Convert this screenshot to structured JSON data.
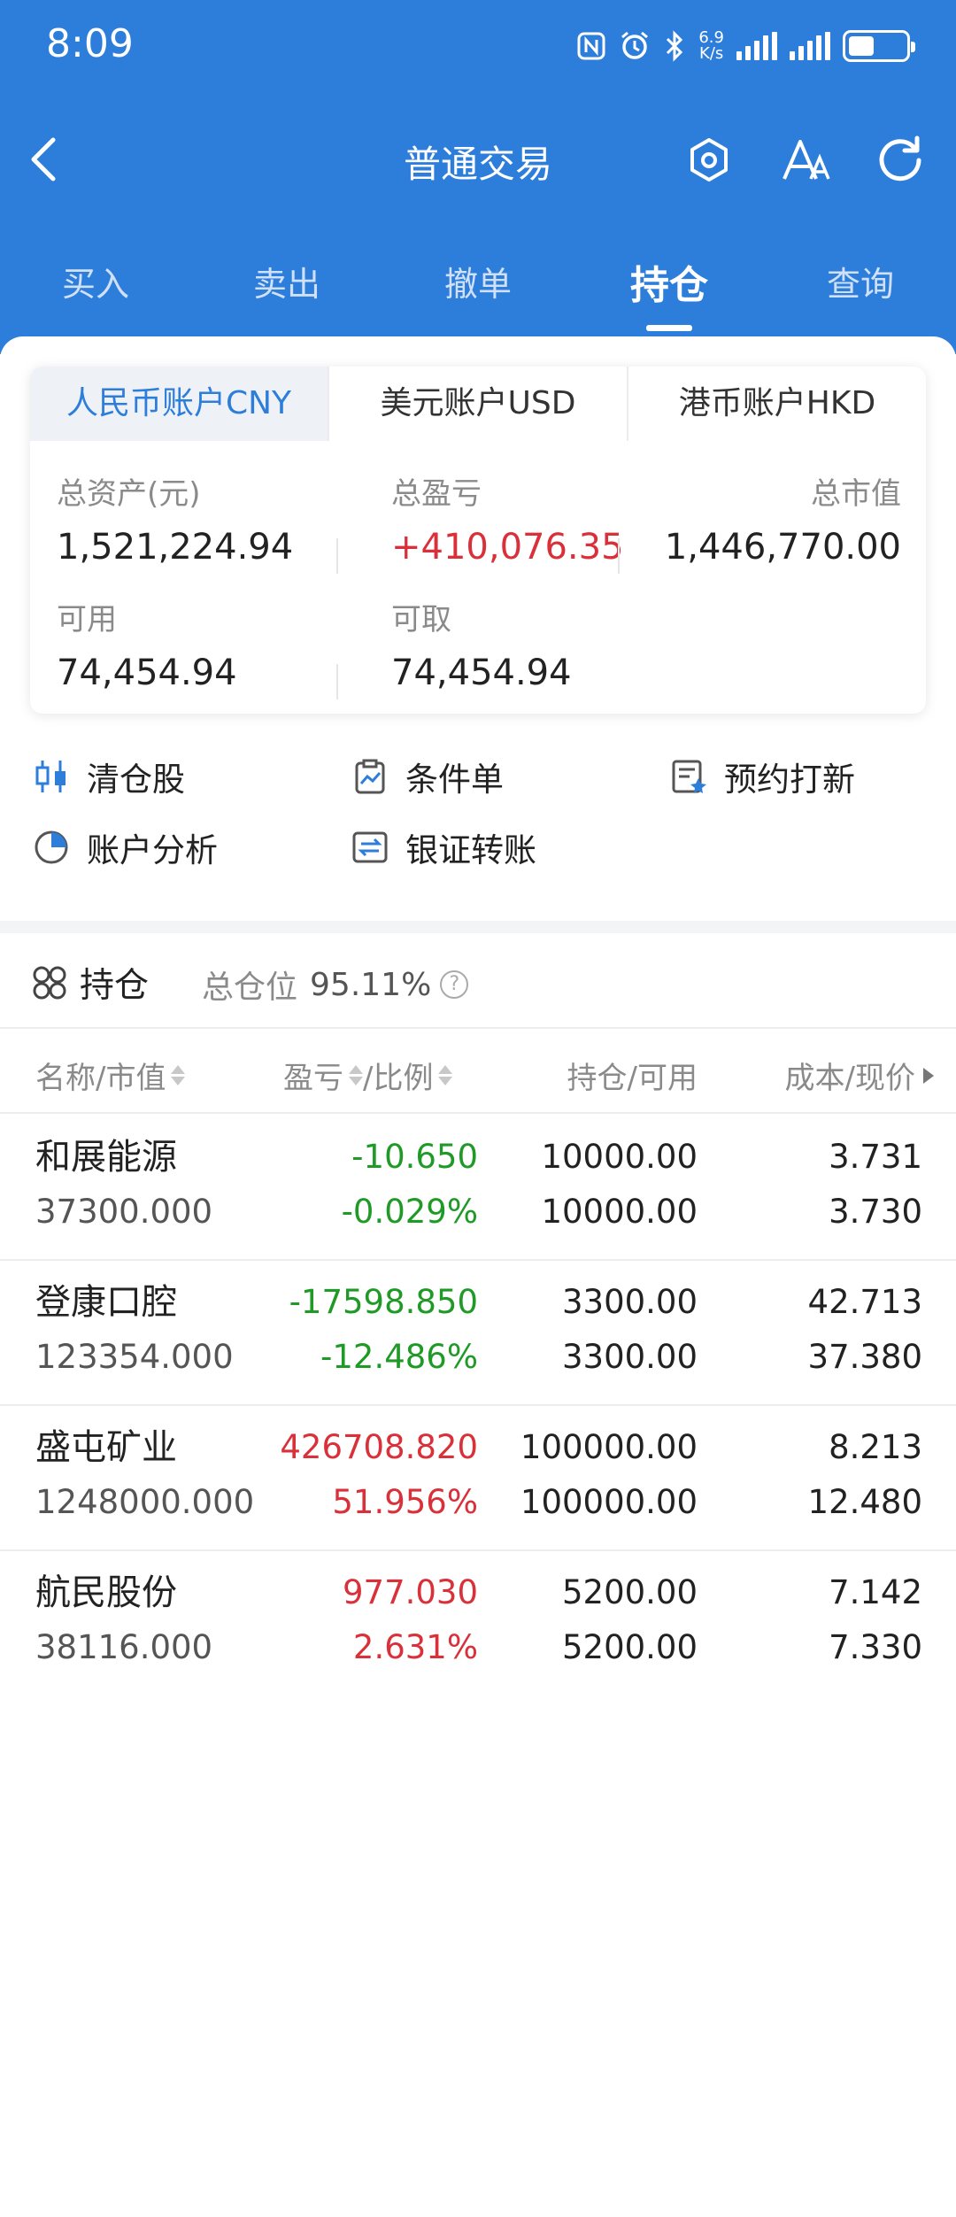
{
  "status_bar": {
    "time": "8:09",
    "network_speed_value": "6.9",
    "network_speed_unit": "K/s",
    "battery_level": 0.45
  },
  "header": {
    "title": "普通交易",
    "tabs": [
      {
        "label": "买入"
      },
      {
        "label": "卖出"
      },
      {
        "label": "撤单"
      },
      {
        "label": "持仓",
        "active": true
      },
      {
        "label": "查询"
      }
    ]
  },
  "account": {
    "tabs": [
      {
        "label": "人民币账户CNY",
        "active": true
      },
      {
        "label": "美元账户USD"
      },
      {
        "label": "港币账户HKD"
      }
    ],
    "total_assets_label": "总资产(元)",
    "total_assets": "1,521,224.94",
    "total_pl_label": "总盈亏",
    "total_pl": "+410,076.35",
    "market_value_label": "总市值",
    "market_value": "1,446,770.00",
    "available_label": "可用",
    "available": "74,454.94",
    "withdrawable_label": "可取",
    "withdrawable": "74,454.94"
  },
  "quick_actions": [
    {
      "label": "清仓股",
      "icon": "candlestick-icon"
    },
    {
      "label": "条件单",
      "icon": "clipboard-chart-icon"
    },
    {
      "label": "预约打新",
      "icon": "reservation-star-icon"
    },
    {
      "label": "账户分析",
      "icon": "pie-chart-icon"
    },
    {
      "label": "银证转账",
      "icon": "transfer-icon"
    }
  ],
  "holdings": {
    "title": "持仓",
    "position_label": "总仓位",
    "position_ratio": "95.11%",
    "columns": {
      "name": "名称/市值",
      "pl": "盈亏",
      "ratio": "/比例",
      "qty": "持仓/可用",
      "price": "成本/现价"
    },
    "rows": [
      {
        "name": "和展能源",
        "market_value": "37300.000",
        "pl": "-10.650",
        "pl_ratio": "-0.029%",
        "holding": "10000.00",
        "available": "10000.00",
        "cost": "3.731",
        "price": "3.730",
        "trend": "down"
      },
      {
        "name": "登康口腔",
        "market_value": "123354.000",
        "pl": "-17598.850",
        "pl_ratio": "-12.486%",
        "holding": "3300.00",
        "available": "3300.00",
        "cost": "42.713",
        "price": "37.380",
        "trend": "down"
      },
      {
        "name": "盛屯矿业",
        "market_value": "1248000.000",
        "pl": "426708.820",
        "pl_ratio": "51.956%",
        "holding": "100000.00",
        "available": "100000.00",
        "cost": "8.213",
        "price": "12.480",
        "trend": "up"
      },
      {
        "name": "航民股份",
        "market_value": "38116.000",
        "pl": "977.030",
        "pl_ratio": "2.631%",
        "holding": "5200.00",
        "available": "5200.00",
        "cost": "7.142",
        "price": "7.330",
        "trend": "up"
      }
    ]
  },
  "colors": {
    "brand_blue": "#2d7ddb",
    "profit_red": "#d9303a",
    "loss_green": "#1f9a26"
  }
}
